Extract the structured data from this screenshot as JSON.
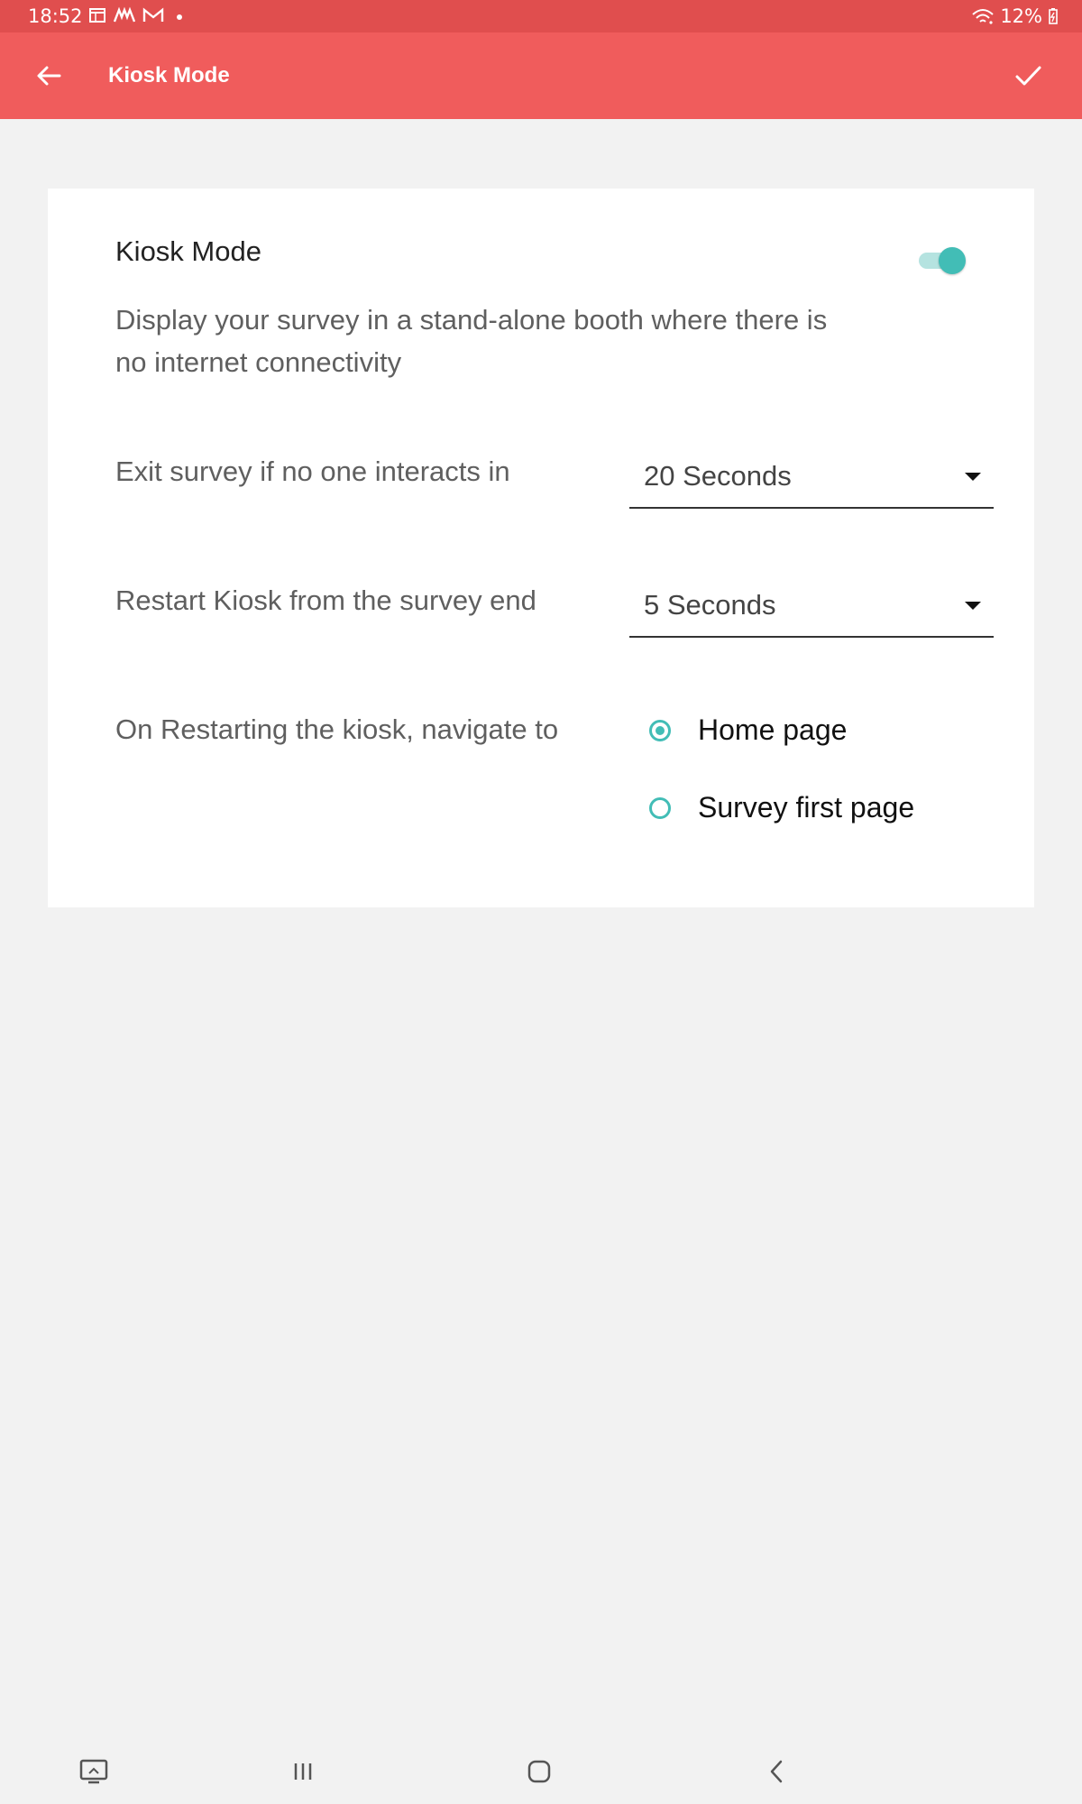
{
  "status_bar": {
    "time": "18:52",
    "battery": "12%",
    "icons": [
      "calendar-icon",
      "app-icon",
      "gmail-icon",
      "wifi-icon",
      "battery-icon"
    ]
  },
  "app_bar": {
    "title": "Kiosk Mode",
    "back_icon": "arrow-left-icon",
    "confirm_icon": "check-icon",
    "color": "#f05c5c"
  },
  "settings": {
    "kiosk_mode": {
      "title": "Kiosk Mode",
      "description": "Display your survey in a stand-alone booth where there is no internet connectivity",
      "enabled": true
    },
    "exit_timeout": {
      "label": "Exit survey if no one interacts in",
      "selected": "20 Seconds"
    },
    "restart_delay": {
      "label": "Restart Kiosk from the survey end",
      "selected": "5 Seconds"
    },
    "restart_target": {
      "label": "On Restarting the kiosk, navigate to",
      "options": [
        {
          "label": "Home page",
          "selected": true
        },
        {
          "label": "Survey first page",
          "selected": false
        }
      ]
    }
  },
  "colors": {
    "accent": "#42bdb6",
    "status_bar": "#e04e4e",
    "background": "#f2f2f2"
  },
  "nav_bar": {
    "icons": [
      "screenshot-icon",
      "recent-apps-icon",
      "home-icon",
      "back-icon"
    ]
  }
}
